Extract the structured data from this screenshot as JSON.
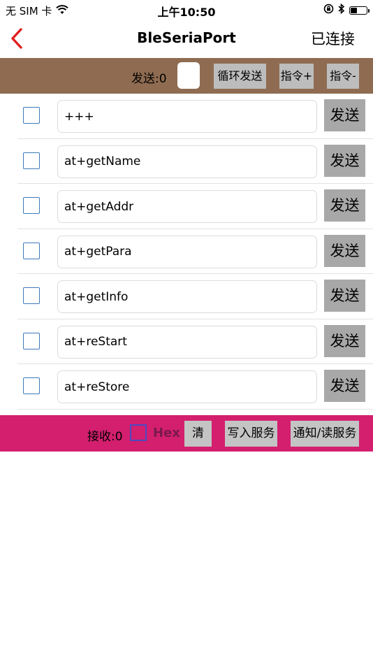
{
  "status_bar": {
    "carrier": "无 SIM 卡",
    "time": "上午10:50",
    "battery_level": 0.45
  },
  "nav": {
    "title": "BleSeriaPort",
    "status": "已连接"
  },
  "send_toolbar": {
    "count_label": "发送:0",
    "loop_send_label": "循环发送",
    "cmd_add_label": "指令+",
    "cmd_remove_label": "指令-"
  },
  "commands": [
    {
      "value": "+++",
      "send_label": "发送"
    },
    {
      "value": "at+getName",
      "send_label": "发送"
    },
    {
      "value": "at+getAddr",
      "send_label": "发送"
    },
    {
      "value": "at+getPara",
      "send_label": "发送"
    },
    {
      "value": "at+getInfo",
      "send_label": "发送"
    },
    {
      "value": "at+reStart",
      "send_label": "发送"
    },
    {
      "value": "at+reStore",
      "send_label": "发送"
    }
  ],
  "recv_toolbar": {
    "count_label": "接收:0",
    "hex_label": "Hex",
    "clear_label": "清",
    "write_service_label": "写入服务",
    "notify_service_label": "通知/读服务"
  },
  "colors": {
    "send_toolbar_bg": "#8f6c51",
    "recv_toolbar_bg": "#d31f6e",
    "back_arrow": "#e0201f",
    "checkbox_border": "#3d7ab8"
  }
}
